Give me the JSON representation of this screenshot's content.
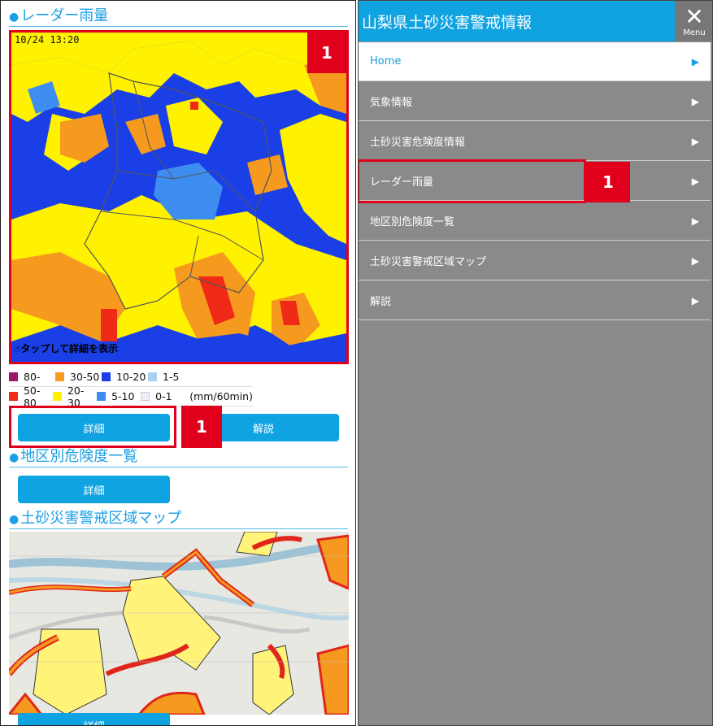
{
  "radar_section": {
    "title": "レーダー雨量",
    "timestamp": "10/24 13:20",
    "hint": "タップして詳細を表示",
    "badge": "1"
  },
  "legend": {
    "row1": [
      {
        "label": "80-",
        "color": "#a0146e"
      },
      {
        "label": "30-50",
        "color": "#f59a1f"
      },
      {
        "label": "10-20",
        "color": "#1a3fe6"
      },
      {
        "label": "1-5",
        "color": "#a9cff2"
      }
    ],
    "row2": [
      {
        "label": "50-80",
        "color": "#ef2a16"
      },
      {
        "label": "20-30",
        "color": "#fff200"
      },
      {
        "label": "5-10",
        "color": "#3d8ef0"
      },
      {
        "label": "0-1",
        "color": "#eeeef8"
      }
    ],
    "unit": "(mm/60min)"
  },
  "buttons": {
    "detail": "詳細",
    "explain": "解説",
    "badge": "1"
  },
  "district_section": {
    "title": "地区別危険度一覧",
    "detail": "詳細"
  },
  "map_section": {
    "title": "土砂災害警戒区域マップ",
    "detail": "詳細"
  },
  "right": {
    "header_title": "山梨県土砂災害警戒情報",
    "menu_label": "Menu",
    "badge": "1",
    "items": [
      {
        "label": "Home"
      },
      {
        "label": "気象情報"
      },
      {
        "label": "土砂災害危険度情報"
      },
      {
        "label": "レーダー雨量"
      },
      {
        "label": "地区別危険度一覧"
      },
      {
        "label": "土砂災害警戒区域マップ"
      },
      {
        "label": "解説"
      }
    ]
  },
  "icons": {
    "dot": "●",
    "arrow": "▶",
    "close": "✕",
    "hand": "☝"
  },
  "colors": {
    "accent": "#0fa3e2",
    "highlight": "#e0001b",
    "menu_bg": "#8a8a8a"
  }
}
